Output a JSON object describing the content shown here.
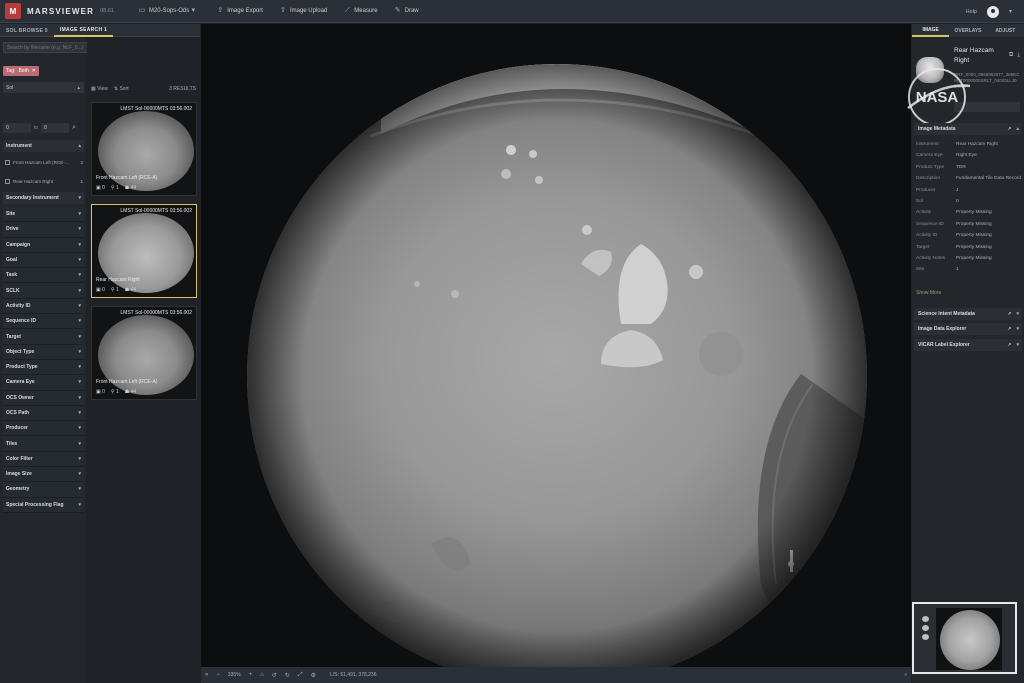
{
  "app": {
    "logo_letter": "M",
    "name": "MARSVIEWER",
    "version": "08.61"
  },
  "top_menu": [
    {
      "icon": "folder-icon",
      "glyph": "▭",
      "label": "M20-Sops-Ods",
      "chevron": "▾"
    },
    {
      "icon": "export-icon",
      "glyph": "⇪",
      "label": "Image Export"
    },
    {
      "icon": "upload-icon",
      "glyph": "⇧",
      "label": "Image Upload"
    },
    {
      "icon": "ruler-icon",
      "glyph": "⟋",
      "label": "Measure"
    },
    {
      "icon": "pencil-icon",
      "glyph": "✎",
      "label": "Draw"
    }
  ],
  "top_right": {
    "help": "Help",
    "chevron": "▾"
  },
  "left_tabs": [
    {
      "label": "SOL BROWSE",
      "count": "0"
    },
    {
      "label": "IMAGE SEARCH",
      "count": "1"
    }
  ],
  "search": {
    "placeholder": "Search by filename (e.g. NLF_0...)",
    "search_glyph": "⌕",
    "reset_glyph": "⟲"
  },
  "tag_chip": {
    "label": "Tag:",
    "value": "Both",
    "close": "✕"
  },
  "sol_select": {
    "label": "Sol",
    "chevron": "▴"
  },
  "range": {
    "from": "0",
    "sep": "to",
    "to": "0",
    "search_glyph": "⌕"
  },
  "instrument": {
    "label": "Instrument",
    "chevron": "▴",
    "options": [
      {
        "label": "Front Hazcam Left (RCE-...",
        "count": "2"
      },
      {
        "label": "Rear Hazcam Right",
        "count": "1"
      }
    ]
  },
  "secondary_instrument": {
    "label": "Secondary Instrument",
    "chevron": "▾"
  },
  "filters": [
    "Site",
    "Drive",
    "Campaign",
    "Goal",
    "Task",
    "SCLK",
    "Activity ID",
    "Sequence ID",
    "Target",
    "Object Type",
    "Product Type",
    "Camera Eye",
    "OCS Owner",
    "OCS Path",
    "Producer",
    "Tiles",
    "Color Filter",
    "Image Size",
    "Geometry",
    "Special Processing Flag"
  ],
  "filter_chevron": "▾",
  "results": {
    "view": "View",
    "sort": "Sort",
    "count": "3 RESULTS",
    "items": [
      {
        "title": "LMST Sol-00000MTS 03:56.002",
        "name": "Front Hazcam Left (RCE-A)",
        "markers": "0",
        "pins": "1",
        "people": "44"
      },
      {
        "title": "LMST Sol-00000MTS 03:56.002",
        "name": "Rear Hazcam Right",
        "markers": "0",
        "pins": "1",
        "people": "44"
      },
      {
        "title": "LMST Sol-00000MTS 03:56.002",
        "name": "Front Hazcam Left (RCE-A)",
        "markers": "0",
        "pins": "1",
        "people": "44"
      }
    ]
  },
  "viewer_bar": {
    "zoom": "335%",
    "coords": "L/S: 51,491, 378,236",
    "expand": "»"
  },
  "right_tabs": [
    "IMAGE",
    "OVERLAYS",
    "ADJUST"
  ],
  "camera": {
    "title": "Rear Hazcam Right",
    "file": "RRF_0000_0666952677_365ECM_T0000000SRLT_04000LLJ01.IMG",
    "external_glyph": "⧉",
    "download_glyph": "⤓"
  },
  "image_metadata": {
    "label": "Image Metadata",
    "rows": [
      {
        "k": "Instrument",
        "v": "Rear Hazcam Right"
      },
      {
        "k": "Camera Eye",
        "v": "Right Eye"
      },
      {
        "k": "Product Type",
        "v": "TDR"
      },
      {
        "k": "Description",
        "v": "Fundamental Tile Data Record"
      },
      {
        "k": "Producer",
        "v": "J"
      },
      {
        "k": "Sol",
        "v": "0"
      },
      {
        "k": "Activity",
        "v": "Property Missing"
      },
      {
        "k": "Sequence ID",
        "v": "Property Missing"
      },
      {
        "k": "Activity ID",
        "v": "Property Missing"
      },
      {
        "k": "Target",
        "v": "Property Missing"
      },
      {
        "k": "Activity Notes",
        "v": "Property Missing"
      },
      {
        "k": "Site",
        "v": "1"
      }
    ],
    "show_more": "Show More"
  },
  "sections": [
    {
      "label": "Science Intent Metadata"
    },
    {
      "label": "Image Data Explorer"
    },
    {
      "label": "VICAR Label Explorer"
    }
  ],
  "nasa": "NASA"
}
